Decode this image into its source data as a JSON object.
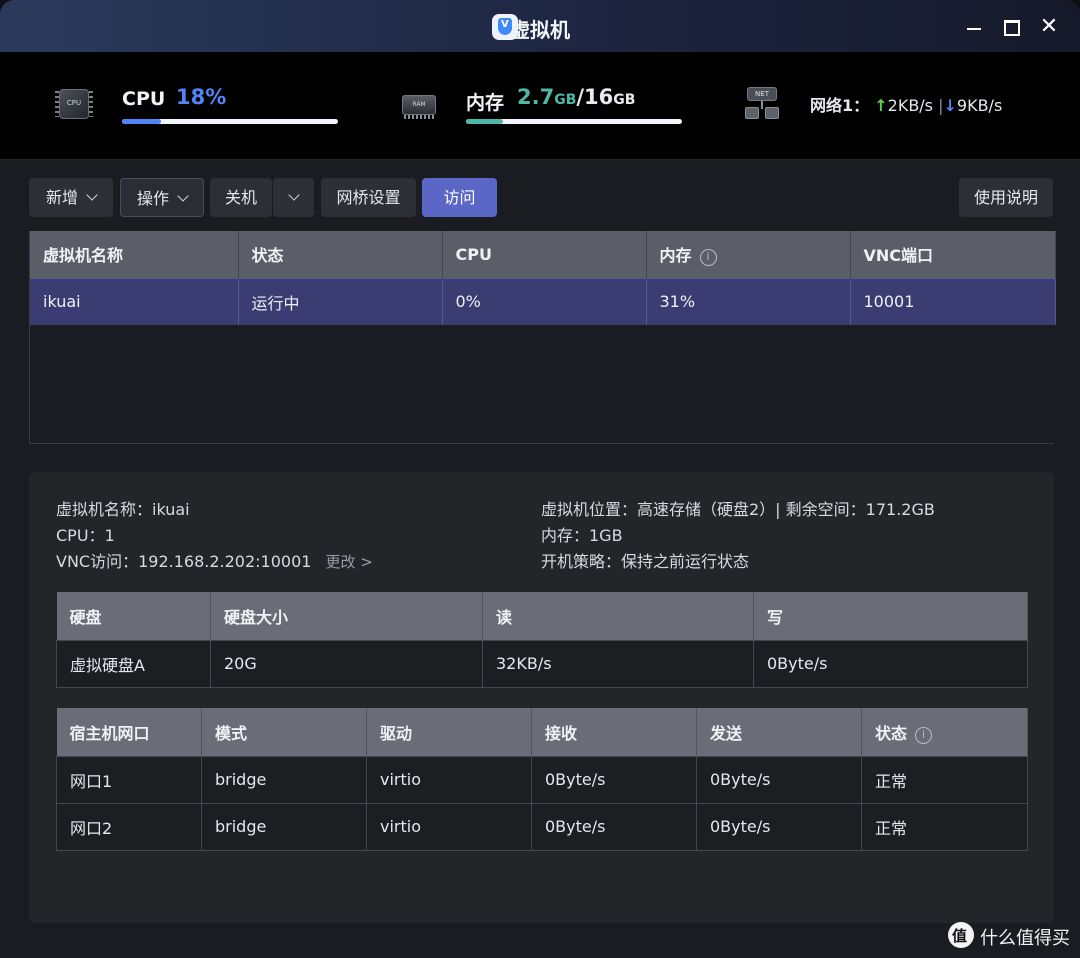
{
  "window": {
    "title": "虚拟机",
    "logo_icon": "shield-v-logo-icon",
    "controls": {
      "minimize_icon": "minimize-icon",
      "maximize_icon": "maximize-icon",
      "close_glyph": "✕"
    }
  },
  "stats": {
    "cpu": {
      "label": "CPU",
      "value": "18%",
      "usage": 0.18,
      "icon": "cpu-chip-icon",
      "icon_text": "CPU",
      "bar_color": "#4f86f7"
    },
    "memory": {
      "label": "内存",
      "used": "2.7",
      "used_unit": "GB",
      "slash": "/",
      "total": "16",
      "total_unit": "GB",
      "usage": 0.17,
      "icon": "ram-module-icon",
      "icon_text": "RAM",
      "bar_color": "#4fb7a7"
    },
    "network": {
      "label": "网络1：",
      "up_arrow": "↑",
      "up": "2KB/s",
      "separator": "|",
      "down_arrow": "↓",
      "down": "9KB/s",
      "icon": "network-icon",
      "icon_text": "NET"
    }
  },
  "toolbar": {
    "add_label": "新增",
    "ops_label": "操作",
    "shutdown_label": "关机",
    "bridge_label": "网桥设置",
    "visit_label": "访问",
    "help_label": "使用说明"
  },
  "vm_table": {
    "headers": [
      "虚拟机名称",
      "状态",
      "CPU",
      "内存",
      "VNC端口"
    ],
    "rows": [
      [
        "ikuai",
        "运行中",
        "0%",
        "31%",
        "10001"
      ]
    ],
    "info_glyph": "i"
  },
  "details": {
    "name": "虚拟机名称：ikuai",
    "cpu": "CPU：1",
    "vnc": "VNC访问：192.168.2.202:10001",
    "vnc_edit": "更改 >",
    "location": "虚拟机位置：高速存储（硬盘2）| 剩余空间：171.2GB",
    "memory": "内存：1GB",
    "boot_policy": "开机策略：保持之前运行状态"
  },
  "disk_table": {
    "headers": [
      "硬盘",
      "硬盘大小",
      "读",
      "写"
    ],
    "rows": [
      [
        "虚拟硬盘A",
        "20G",
        "32KB/s",
        "0Byte/s"
      ]
    ]
  },
  "nic_table": {
    "headers": [
      "宿主机网口",
      "模式",
      "驱动",
      "接收",
      "发送",
      "状态"
    ],
    "rows": [
      [
        "网口1",
        "bridge",
        "virtio",
        "0Byte/s",
        "0Byte/s",
        "正常"
      ],
      [
        "网口2",
        "bridge",
        "virtio",
        "0Byte/s",
        "0Byte/s",
        "正常"
      ]
    ]
  },
  "watermark": {
    "text": "什么值得买",
    "badge_icon": "smzdm-logo-icon"
  }
}
